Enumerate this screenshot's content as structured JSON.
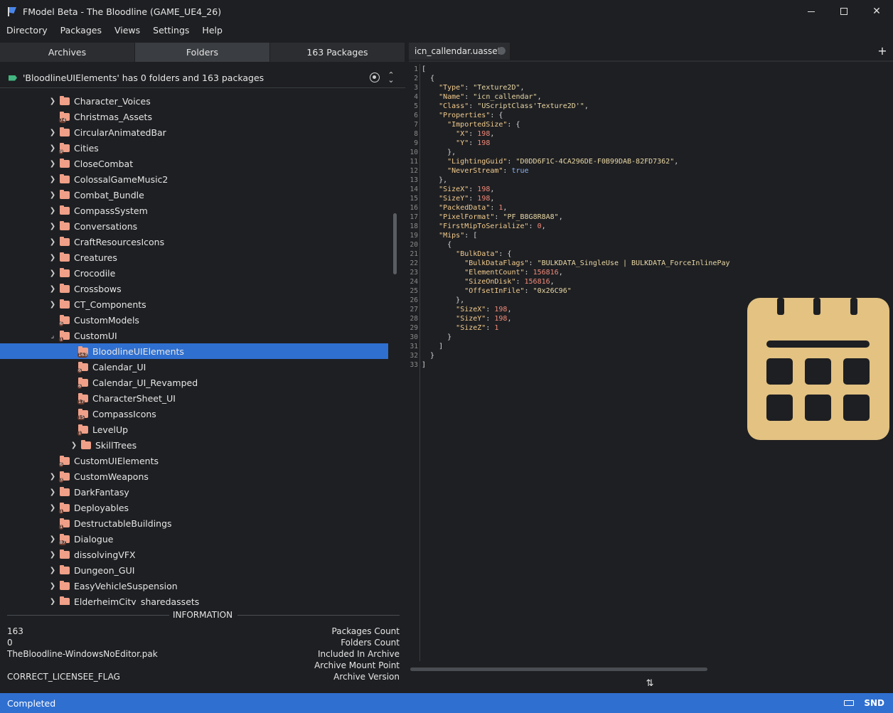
{
  "window": {
    "title": "FModel Beta - The Bloodline (GAME_UE4_26)"
  },
  "menu": [
    "Directory",
    "Packages",
    "Views",
    "Settings",
    "Help"
  ],
  "left_tabs": [
    {
      "label": "Archives",
      "active": false
    },
    {
      "label": "Folders",
      "active": true
    },
    {
      "label": "163 Packages",
      "active": false
    }
  ],
  "status_line": "'BloodlineUIElements' has 0 folders and 163 packages",
  "tree": [
    {
      "label": "Character_Voices",
      "indent": 0,
      "chevron": "right",
      "badge": ""
    },
    {
      "label": "Christmas_Assets",
      "indent": 0,
      "chevron": "",
      "badge": "74"
    },
    {
      "label": "CircularAnimatedBar",
      "indent": 0,
      "chevron": "right",
      "badge": ""
    },
    {
      "label": "Cities",
      "indent": 0,
      "chevron": "right",
      "badge": "9"
    },
    {
      "label": "CloseCombat",
      "indent": 0,
      "chevron": "right",
      "badge": ""
    },
    {
      "label": "ColossalGameMusic2",
      "indent": 0,
      "chevron": "right",
      "badge": ""
    },
    {
      "label": "Combat_Bundle",
      "indent": 0,
      "chevron": "right",
      "badge": ""
    },
    {
      "label": "CompassSystem",
      "indent": 0,
      "chevron": "right",
      "badge": ""
    },
    {
      "label": "Conversations",
      "indent": 0,
      "chevron": "right",
      "badge": ""
    },
    {
      "label": "CraftResourcesIcons",
      "indent": 0,
      "chevron": "right",
      "badge": ""
    },
    {
      "label": "Creatures",
      "indent": 0,
      "chevron": "right",
      "badge": ""
    },
    {
      "label": "Crocodile",
      "indent": 0,
      "chevron": "right",
      "badge": ""
    },
    {
      "label": "Crossbows",
      "indent": 0,
      "chevron": "right",
      "badge": ""
    },
    {
      "label": "CT_Components",
      "indent": 0,
      "chevron": "right",
      "badge": ""
    },
    {
      "label": "CustomModels",
      "indent": 0,
      "chevron": "",
      "badge": "6"
    },
    {
      "label": "CustomUI",
      "indent": 0,
      "chevron": "down",
      "badge": "1"
    },
    {
      "label": "BloodlineUIElements",
      "indent": 1,
      "chevron": "",
      "badge": "163",
      "selected": true
    },
    {
      "label": "Calendar_UI",
      "indent": 1,
      "chevron": "",
      "badge": "6"
    },
    {
      "label": "Calendar_UI_Revamped",
      "indent": 1,
      "chevron": "",
      "badge": "6"
    },
    {
      "label": "CharacterSheet_UI",
      "indent": 1,
      "chevron": "",
      "badge": "17"
    },
    {
      "label": "CompassIcons",
      "indent": 1,
      "chevron": "",
      "badge": "15"
    },
    {
      "label": "LevelUp",
      "indent": 1,
      "chevron": "",
      "badge": "1"
    },
    {
      "label": "SkillTrees",
      "indent": 1,
      "chevron": "right",
      "badge": ""
    },
    {
      "label": "CustomUIElements",
      "indent": 0,
      "chevron": "",
      "badge": "6"
    },
    {
      "label": "CustomWeapons",
      "indent": 0,
      "chevron": "right",
      "badge": "3"
    },
    {
      "label": "DarkFantasy",
      "indent": 0,
      "chevron": "right",
      "badge": ""
    },
    {
      "label": "Deployables",
      "indent": 0,
      "chevron": "right",
      "badge": "1"
    },
    {
      "label": "DestructableBuildings",
      "indent": 0,
      "chevron": "",
      "badge": "1"
    },
    {
      "label": "Dialogue",
      "indent": 0,
      "chevron": "right",
      "badge": "87"
    },
    {
      "label": "dissolvingVFX",
      "indent": 0,
      "chevron": "right",
      "badge": ""
    },
    {
      "label": "Dungeon_GUI",
      "indent": 0,
      "chevron": "right",
      "badge": ""
    },
    {
      "label": "EasyVehicleSuspension",
      "indent": 0,
      "chevron": "right",
      "badge": ""
    },
    {
      "label": "ElderheimCity_sharedassets",
      "indent": 0,
      "chevron": "right",
      "badge": ""
    }
  ],
  "info": {
    "heading": "INFORMATION",
    "rows": [
      {
        "value": "163",
        "label": "Packages Count"
      },
      {
        "value": "0",
        "label": "Folders Count"
      },
      {
        "value": "TheBloodline-WindowsNoEditor.pak",
        "label": "Included In Archive"
      },
      {
        "value": "",
        "label": "Archive Mount Point"
      },
      {
        "value": "CORRECT_LICENSEE_FLAG",
        "label": "Archive Version"
      }
    ]
  },
  "document_tab": {
    "label": "icn_callendar.uasset"
  },
  "code": [
    "[",
    "  {",
    "    \"Type\": \"Texture2D\",",
    "    \"Name\": \"icn_callendar\",",
    "    \"Class\": \"UScriptClass'Texture2D'\",",
    "    \"Properties\": {",
    "      \"ImportedSize\": {",
    "        \"X\": 198,",
    "        \"Y\": 198",
    "      },",
    "      \"LightingGuid\": \"D0DD6F1C-4CA296DE-F0B99DAB-82FD7362\",",
    "      \"NeverStream\": true",
    "    },",
    "    \"SizeX\": 198,",
    "    \"SizeY\": 198,",
    "    \"PackedData\": 1,",
    "    \"PixelFormat\": \"PF_B8G8R8A8\",",
    "    \"FirstMipToSerialize\": 0,",
    "    \"Mips\": [",
    "      {",
    "        \"BulkData\": {",
    "          \"BulkDataFlags\": \"BULKDATA_SingleUse | BULKDATA_ForceInlinePay",
    "          \"ElementCount\": 156816,",
    "          \"SizeOnDisk\": 156816,",
    "          \"OffsetInFile\": \"0x26C96\"",
    "        },",
    "        \"SizeX\": 198,",
    "        \"SizeY\": 198,",
    "        \"SizeZ\": 1",
    "      }",
    "    ]",
    "  }",
    "]"
  ],
  "statusbar": {
    "text": "Completed",
    "right": "SND"
  },
  "colors": {
    "accent": "#2f6fd0",
    "folder": "#f0a088",
    "calendar": "#e3c282"
  }
}
